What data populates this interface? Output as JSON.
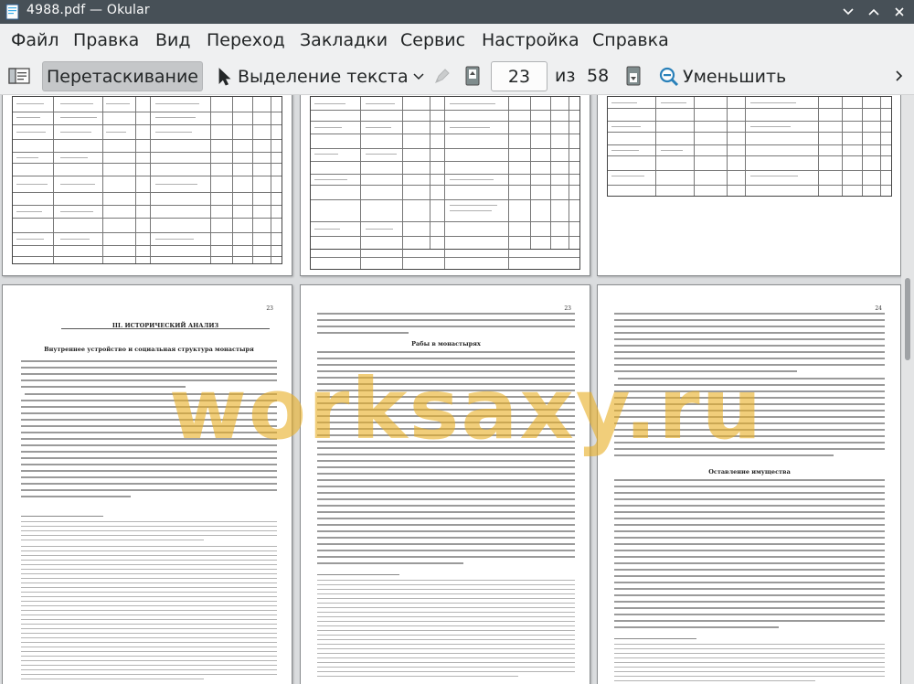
{
  "window": {
    "title": "4988.pdf  — Okular",
    "controls": [
      "chevron-down-icon",
      "chevron-up-icon",
      "close-icon"
    ]
  },
  "menu": [
    "Файл",
    "Правка",
    "Вид",
    "Переход",
    "Закладки",
    "Сервис",
    "Настройка",
    "Справка"
  ],
  "toolbar": {
    "browse_label": "Перетаскивание",
    "text_select_label": "Выделение текста",
    "current_page": "23",
    "of_label": "из",
    "total_pages": "58",
    "zoom_out_label": "Уменьшить",
    "icons": [
      "sidebar-icon",
      "cursor-icon",
      "chevron-down-icon",
      "annotation-icon",
      "page-up-icon",
      "page-down-icon",
      "zoom-out-icon",
      "chevron-right-icon"
    ]
  },
  "document": {
    "visible_pages": [
      {
        "number": "23",
        "heading": "III. ИСТОРИЧЕСКИЙ АНАЛИЗ",
        "subheading": "Внутреннее устройство и социальная структура монастыря"
      },
      {
        "number": "23",
        "subheading": "Рабы в монастырях"
      },
      {
        "number": "24",
        "subheading": "Оставление имущества"
      }
    ],
    "watermark": "worksaxy.ru"
  },
  "colors": {
    "titlebar": "#475057",
    "window_bg": "#eff0f1",
    "viewport_bg": "#dadcde",
    "watermark": "#e8b028"
  }
}
